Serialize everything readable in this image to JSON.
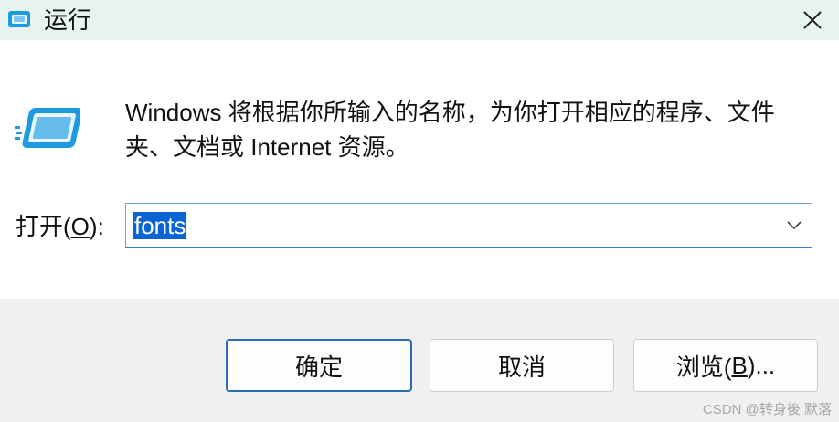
{
  "window": {
    "title": "运行",
    "close_icon": "close-icon"
  },
  "content": {
    "app_icon": "run-dialog-icon",
    "description": "Windows 将根据你所输入的名称，为你打开相应的程序、文件夹、文档或 Internet 资源。"
  },
  "open_field": {
    "label_prefix": "打开(",
    "label_access_key": "O",
    "label_suffix": "):",
    "value": "fonts",
    "dropdown_icon": "chevron-down-icon"
  },
  "buttons": {
    "ok": "确定",
    "cancel": "取消",
    "browse_prefix": "浏览(",
    "browse_access_key": "B",
    "browse_suffix": ")..."
  },
  "watermark": "CSDN @转身後 默落",
  "colors": {
    "titlebar_bg": "#e6f3ee",
    "selection_bg": "#0a64d6",
    "input_focus_border": "#3c7fc6",
    "footer_bg": "#f0f0f0",
    "icon_blue": "#1e9ae0"
  }
}
